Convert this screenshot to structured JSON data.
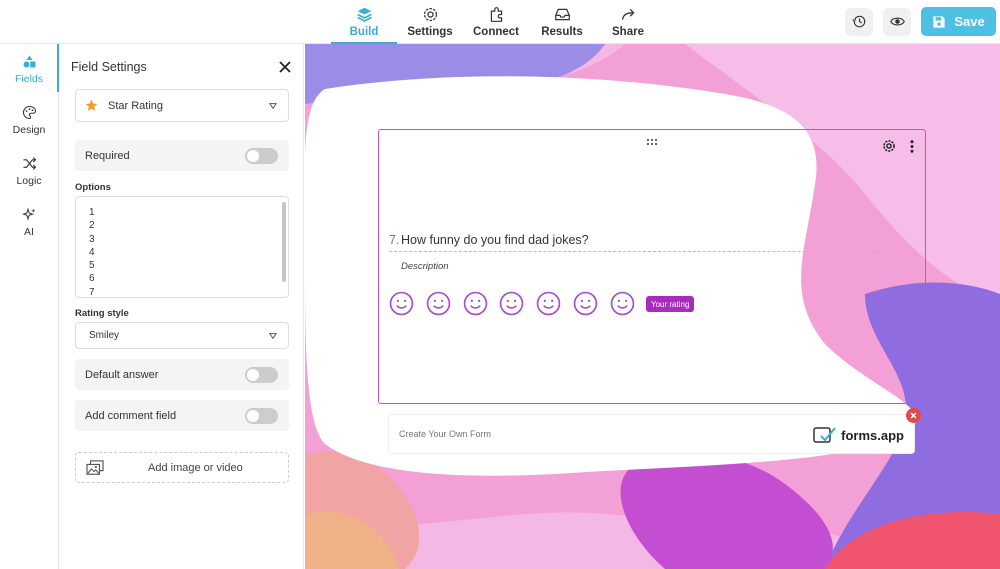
{
  "nav": {
    "build": "Build",
    "settings": "Settings",
    "connect": "Connect",
    "results": "Results",
    "share": "Share",
    "active": "build"
  },
  "toolbar": {
    "save_label": "Save"
  },
  "rail": [
    {
      "label": "Fields",
      "icon": "shapes-icon",
      "active": true
    },
    {
      "label": "Design",
      "icon": "palette-icon"
    },
    {
      "label": "Logic",
      "icon": "shuffle-icon"
    },
    {
      "label": "AI",
      "icon": "sparkles-icon"
    }
  ],
  "panel": {
    "title": "Field Settings",
    "field_type": "Star Rating",
    "required_label": "Required",
    "options_label": "Options",
    "options": [
      "1",
      "2",
      "3",
      "4",
      "5",
      "6",
      "7"
    ],
    "rating_style_label": "Rating style",
    "rating_style_value": "Smiley",
    "default_answer_label": "Default answer",
    "comment_label": "Add comment field",
    "media_label": "Add image or video"
  },
  "question": {
    "number": "7.",
    "text": "How funny do you find dad jokes?",
    "description": "Description",
    "rating_count": 7,
    "badge": "Your rating"
  },
  "branding": {
    "create_text": "Create Your Own Form",
    "logo_text": "forms.app"
  },
  "colors": {
    "accent": "#3aaed8",
    "save_bg": "#4ec0e4",
    "question_accent": "#a64fc9",
    "badge": "#a92bbd"
  }
}
